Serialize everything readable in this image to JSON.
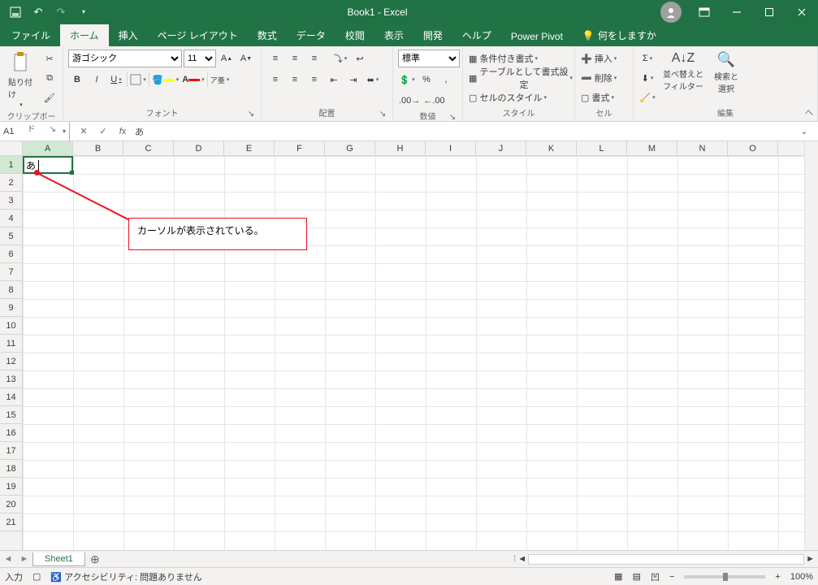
{
  "title": "Book1  -  Excel",
  "qat": {
    "save": "保存",
    "undo": "元に戻す",
    "redo": "やり直し"
  },
  "tabs": {
    "file": "ファイル",
    "home": "ホーム",
    "insert": "挿入",
    "layout": "ページ レイアウト",
    "formulas": "数式",
    "data": "データ",
    "review": "校閲",
    "view": "表示",
    "developer": "開発",
    "help": "ヘルプ",
    "powerpivot": "Power Pivot",
    "tellme": "何をしますか"
  },
  "ribbon": {
    "clipboard": {
      "paste": "貼り付け",
      "label": "クリップボード"
    },
    "font": {
      "name": "游ゴシック",
      "size": "11",
      "bold": "B",
      "italic": "I",
      "underline": "U",
      "label": "フォント"
    },
    "alignment": {
      "label": "配置"
    },
    "number": {
      "format": "標準",
      "label": "数値"
    },
    "styles": {
      "cond": "条件付き書式",
      "table": "テーブルとして書式設定",
      "cell": "セルのスタイル",
      "label": "スタイル"
    },
    "cells": {
      "insert": "挿入",
      "delete": "削除",
      "format": "書式",
      "label": "セル"
    },
    "editing": {
      "sort": "並べ替えと\nフィルター",
      "find": "検索と\n選択",
      "label": "編集"
    }
  },
  "namebox": "A1",
  "formula_value": "あ",
  "columns": [
    "A",
    "B",
    "C",
    "D",
    "E",
    "F",
    "G",
    "H",
    "I",
    "J",
    "K",
    "L",
    "M",
    "N",
    "O"
  ],
  "rows": [
    "1",
    "2",
    "3",
    "4",
    "5",
    "6",
    "7",
    "8",
    "9",
    "10",
    "11",
    "12",
    "13",
    "14",
    "15",
    "16",
    "17",
    "18",
    "19",
    "20",
    "21"
  ],
  "cell_value": "あ",
  "callout_text": "カーソルが表示されている。",
  "sheet_tab": "Sheet1",
  "status": {
    "mode": "入力",
    "accessibility": "アクセシビリティ: 問題ありません",
    "zoom": "100%"
  }
}
